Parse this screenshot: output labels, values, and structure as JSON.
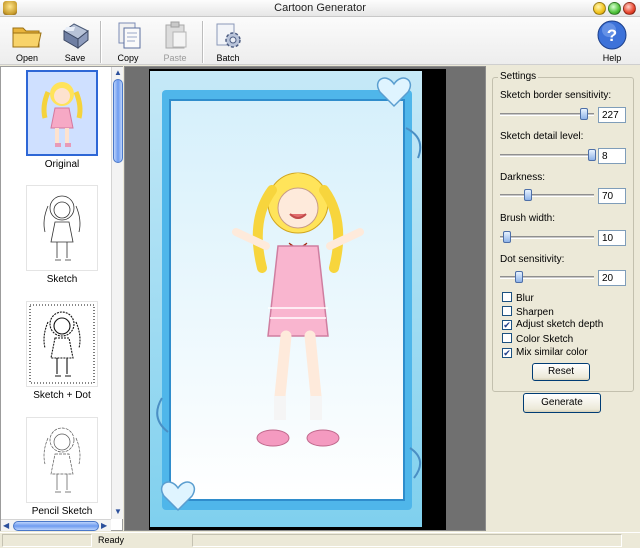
{
  "window": {
    "title": "Cartoon Generator"
  },
  "toolbar": {
    "open": "Open",
    "save": "Save",
    "copy": "Copy",
    "paste": "Paste",
    "batch": "Batch",
    "help": "Help"
  },
  "thumbnails": [
    {
      "label": "Original",
      "selected": true
    },
    {
      "label": "Sketch",
      "selected": false
    },
    {
      "label": "Sketch + Dot",
      "selected": false
    },
    {
      "label": "Pencil Sketch",
      "selected": false
    }
  ],
  "settings": {
    "title": "Settings",
    "sliders": [
      {
        "label": "Sketch border sensitivity:",
        "value": "227",
        "level": 0.89
      },
      {
        "label": "Sketch detail level:",
        "value": "8",
        "level": 0.98
      },
      {
        "label": "Darkness:",
        "value": "70",
        "level": 0.3
      },
      {
        "label": "Brush width:",
        "value": "10",
        "level": 0.07
      },
      {
        "label": "Dot sensitivity:",
        "value": "20",
        "level": 0.2
      }
    ],
    "checks": [
      {
        "label": "Blur",
        "checked": false
      },
      {
        "label": "Sharpen",
        "checked": false
      },
      {
        "label": "Adjust sketch depth",
        "checked": true
      },
      {
        "label": "Color Sketch",
        "checked": false
      },
      {
        "label": "Mix similar color",
        "checked": true
      }
    ],
    "reset": "Reset",
    "generate": "Generate"
  },
  "status": {
    "text": "Ready"
  }
}
